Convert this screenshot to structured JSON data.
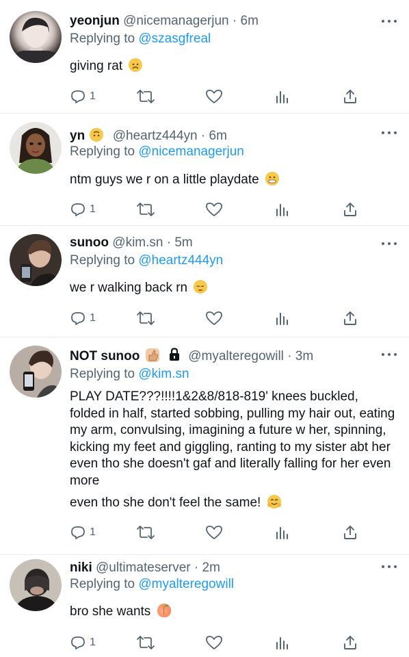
{
  "tweets": [
    {
      "name": "yeonjun",
      "handle": "@nicemanagerjun",
      "time": "6m",
      "reply_prefix": "Replying to",
      "reply_to": "@szasgfreal",
      "text": "giving rat",
      "text_emoji": "worried-face",
      "reply_count": "1"
    },
    {
      "name": "yn",
      "name_emoji": "upside-down-face",
      "handle": "@heartz444yn",
      "time": "6m",
      "reply_prefix": "Replying to",
      "reply_to": "@nicemanagerjun",
      "text": "ntm guys we r on a little playdate",
      "text_emoji": "grimacing-face",
      "reply_count": "1"
    },
    {
      "name": "sunoo",
      "handle": "@kim.sn",
      "time": "5m",
      "reply_prefix": "Replying to",
      "reply_to": "@heartz444yn",
      "text": "we r walking back rn",
      "text_emoji": "pensive-face",
      "reply_count": "1"
    },
    {
      "name": "NOT sunoo",
      "name_emoji": "thumbs-up",
      "name_lock": "lock-icon",
      "handle": "@myalteregowill",
      "time": "3m",
      "reply_prefix": "Replying to",
      "reply_to": "@kim.sn",
      "text": "PLAY DATE???!!!!1&2&8/818-819' knees buckled, folded in half, started sobbing, pulling my hair out, eating my arm,  convulsing, imagining a future w her, spinning, kicking my feet and giggling, ranting to my sister abt her even tho she doesn't gaf and literally falling for her even more",
      "text_2": "even tho she don't feel the same!",
      "text_emoji": "hugging-face",
      "reply_count": "1"
    },
    {
      "name": "niki",
      "handle": "@ultimateserver",
      "time": "2m",
      "reply_prefix": "Replying to",
      "reply_to": "@myalteregowill",
      "text": "bro she wants",
      "text_emoji": "peach",
      "reply_count": "1"
    }
  ],
  "separator": "·",
  "colors": {
    "link": "#1d9bf0",
    "secondary": "#536471",
    "text": "#0f1419"
  }
}
